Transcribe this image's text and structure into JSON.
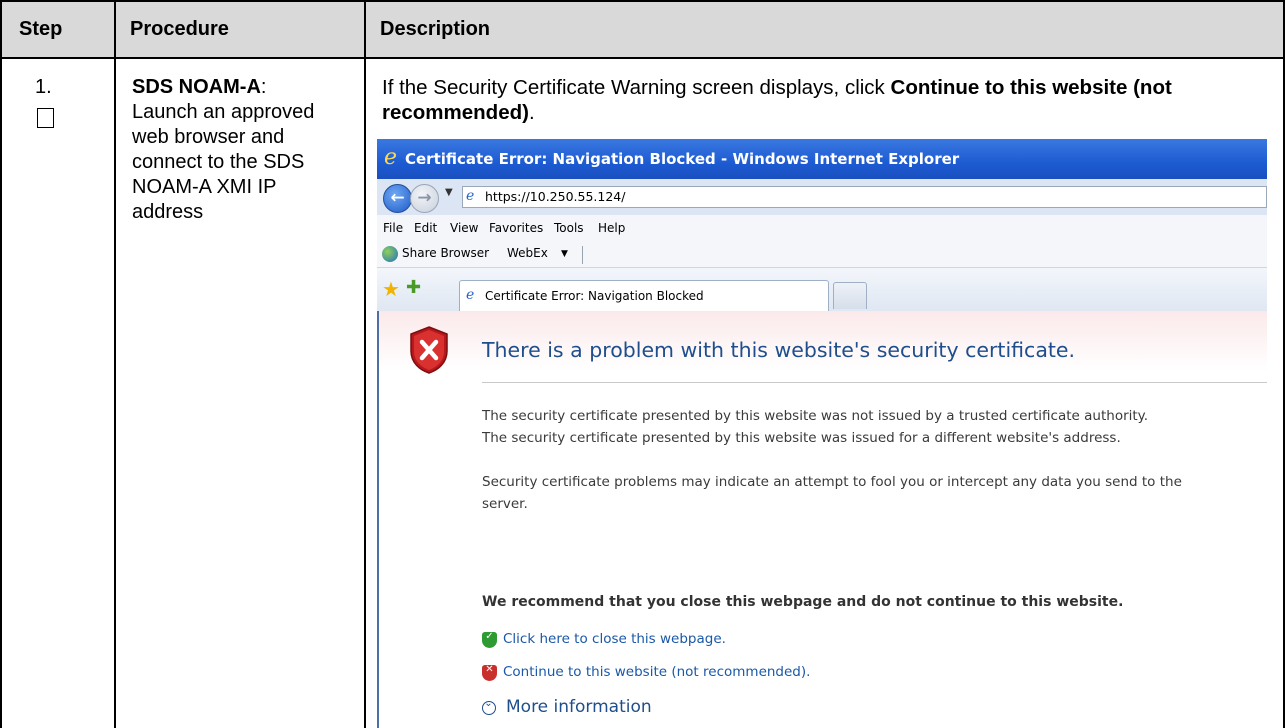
{
  "table": {
    "headers": {
      "step": "Step",
      "procedure": "Procedure",
      "description": "Description"
    },
    "row": {
      "step_number": "1.",
      "procedure_title": "SDS NOAM-A",
      "procedure_title_suffix": ":",
      "procedure_text": "Launch an approved web browser and connect to the SDS NOAM-A XMI IP address",
      "description_intro": "If the Security Certificate Warning screen displays, click ",
      "description_bold": "Continue to this website (not recommended)",
      "description_end": "."
    }
  },
  "browser": {
    "window_title": "Certificate Error: Navigation Blocked - Windows Internet Explorer",
    "address": "https://10.250.55.124/",
    "menu": [
      "File",
      "Edit",
      "View",
      "Favorites",
      "Tools",
      "Help"
    ],
    "links_bar": {
      "share": "Share Browser",
      "webex": "WebEx"
    },
    "tab_title": "Certificate Error: Navigation Blocked"
  },
  "page": {
    "heading": "There is a problem with this website's security certificate.",
    "lines": [
      "The security certificate presented by this website was not issued by a trusted certificate authority.",
      "The security certificate presented by this website was issued for a different website's address.",
      "Security certificate problems may indicate an attempt to fool you or intercept any data you send to the",
      "server."
    ],
    "recommendation": "We recommend that you close this webpage and do not continue to this website.",
    "close_link": "Click here to close this webpage.",
    "continue_link": "Continue to this website (not recommended).",
    "more_info": "More information"
  },
  "colors": {
    "header_bg": "#d9d9d9",
    "titlebar": "#1d5bd3",
    "heading": "#1f4e8c",
    "link": "#1a58a8"
  },
  "icons": [
    "checkbox-icon",
    "ie-logo-icon",
    "back-arrow-icon",
    "forward-arrow-icon",
    "favorites-star-icon",
    "add-favorite-icon",
    "error-shield-icon",
    "green-shield-icon",
    "red-shield-icon",
    "expand-circle-icon",
    "globe-icon"
  ]
}
